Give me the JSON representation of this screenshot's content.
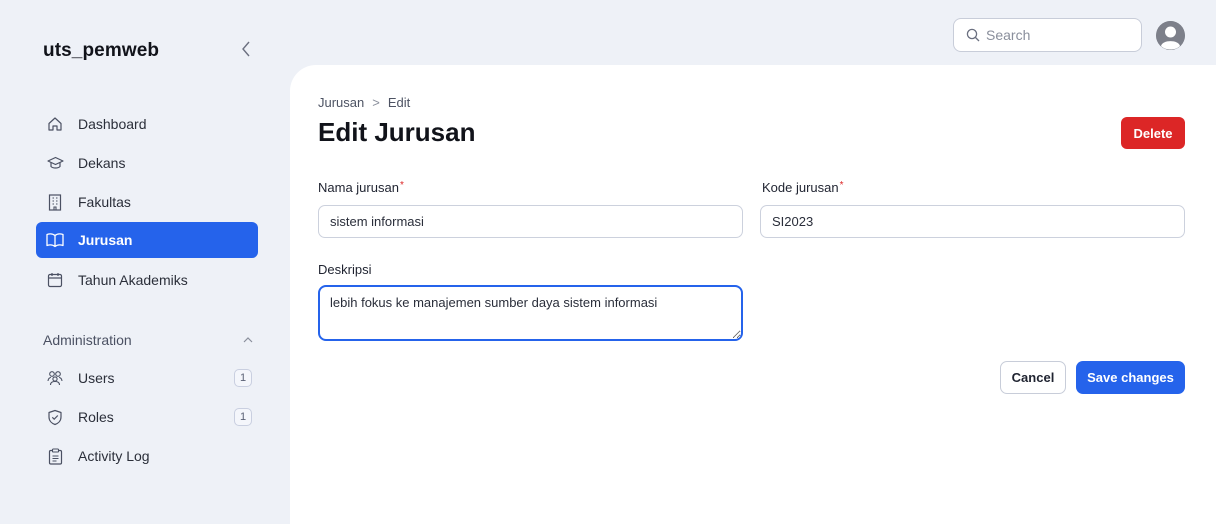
{
  "app": {
    "brand": "uts_pemweb"
  },
  "topbar": {
    "search_placeholder": "Search"
  },
  "sidebar": {
    "items": [
      {
        "label": "Dashboard",
        "icon": "home-icon"
      },
      {
        "label": "Dekans",
        "icon": "graduation-cap-icon"
      },
      {
        "label": "Fakultas",
        "icon": "building-icon"
      },
      {
        "label": "Jurusan",
        "icon": "book-open-icon",
        "active": true
      },
      {
        "label": "Tahun Akademiks",
        "icon": "calendar-icon"
      }
    ],
    "group": {
      "label": "Administration",
      "items": [
        {
          "label": "Users",
          "icon": "users-icon",
          "badge": "1"
        },
        {
          "label": "Roles",
          "icon": "shield-check-icon",
          "badge": "1"
        },
        {
          "label": "Activity Log",
          "icon": "clipboard-icon"
        }
      ]
    }
  },
  "main": {
    "breadcrumb": {
      "parent": "Jurusan",
      "separator": ">",
      "current": "Edit"
    },
    "title": "Edit Jurusan",
    "delete_label": "Delete",
    "form": {
      "nama": {
        "label": "Nama jurusan",
        "required_mark": "*",
        "value": "sistem informasi"
      },
      "kode": {
        "label": "Kode jurusan",
        "required_mark": "*",
        "value": "SI2023"
      },
      "deskripsi": {
        "label": "Deskripsi",
        "value": "lebih fokus ke manajemen sumber daya sistem informasi"
      }
    },
    "cancel_label": "Cancel",
    "save_label": "Save changes"
  },
  "colors": {
    "accent": "#2563eb",
    "danger": "#dc2626"
  }
}
